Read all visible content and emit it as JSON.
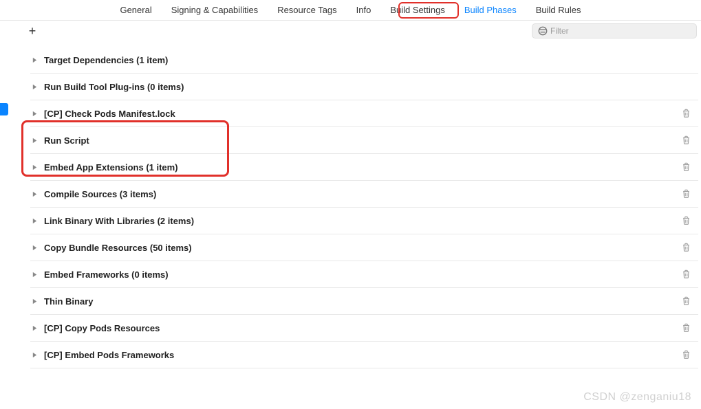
{
  "tabs": [
    {
      "label": "General"
    },
    {
      "label": "Signing & Capabilities"
    },
    {
      "label": "Resource Tags"
    },
    {
      "label": "Info"
    },
    {
      "label": "Build Settings"
    },
    {
      "label": "Build Phases",
      "active": true
    },
    {
      "label": "Build Rules"
    }
  ],
  "filter": {
    "placeholder": "Filter"
  },
  "phases": [
    {
      "label": "Target Dependencies (1 item)",
      "trash": false
    },
    {
      "label": "Run Build Tool Plug-ins (0 items)",
      "trash": false
    },
    {
      "label": "[CP] Check Pods Manifest.lock",
      "trash": true
    },
    {
      "label": "Run Script",
      "trash": true
    },
    {
      "label": "Embed App Extensions (1 item)",
      "trash": true
    },
    {
      "label": "Compile Sources (3 items)",
      "trash": true
    },
    {
      "label": "Link Binary With Libraries (2 items)",
      "trash": true
    },
    {
      "label": "Copy Bundle Resources (50 items)",
      "trash": true
    },
    {
      "label": "Embed Frameworks (0 items)",
      "trash": true
    },
    {
      "label": "Thin Binary",
      "trash": true
    },
    {
      "label": "[CP] Copy Pods Resources",
      "trash": true
    },
    {
      "label": "[CP] Embed Pods Frameworks",
      "trash": true
    }
  ],
  "watermark": "CSDN @zenganiu18"
}
